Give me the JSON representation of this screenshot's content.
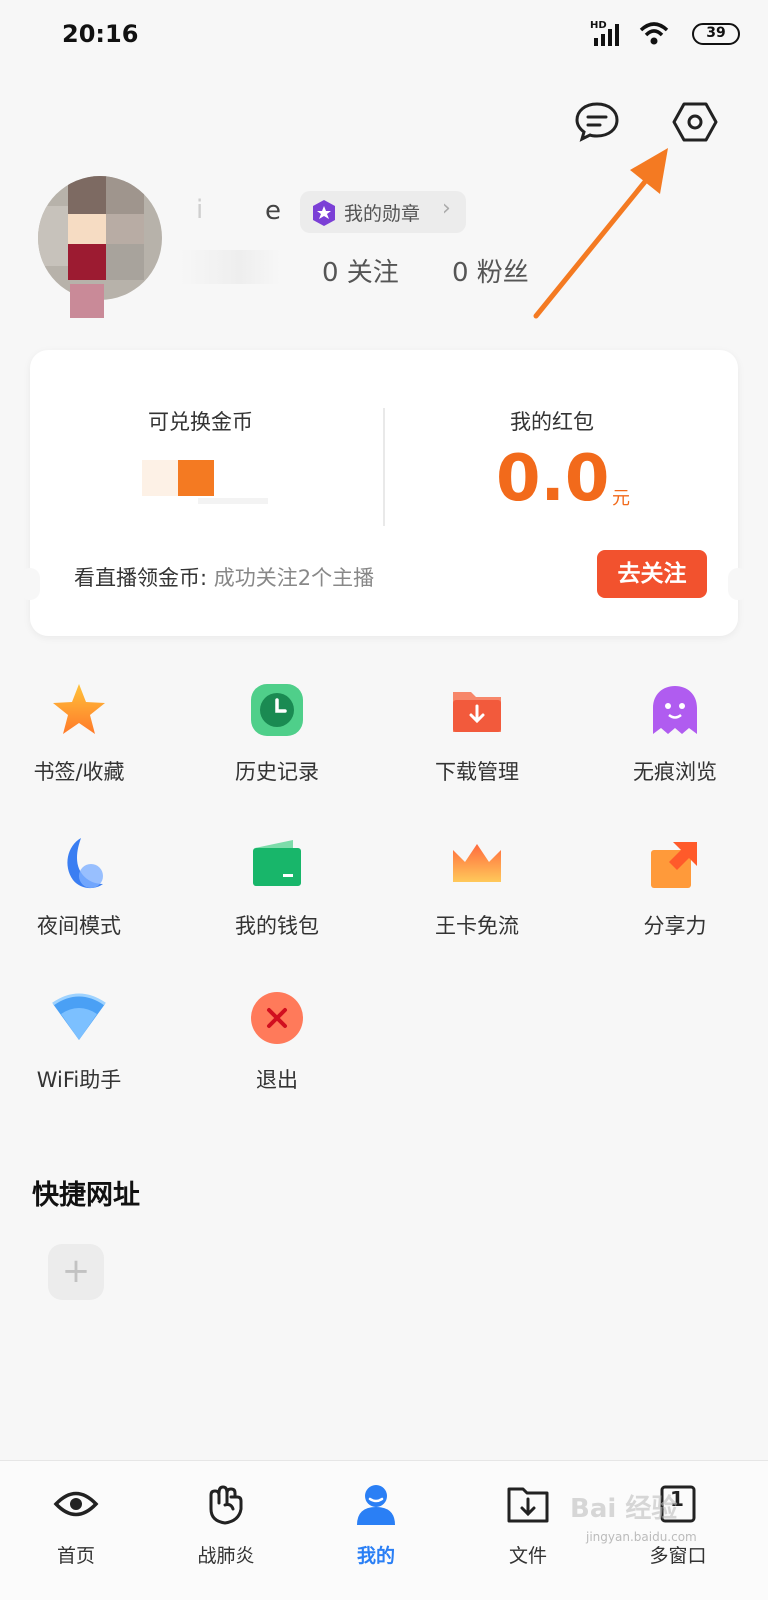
{
  "status_bar": {
    "time": "20:16",
    "network": "HD",
    "battery": "39"
  },
  "header": {
    "message_icon": "message-icon",
    "settings_icon": "settings-hexagon-icon"
  },
  "profile": {
    "username_visible": "e",
    "medal_label": "我的勋章",
    "following": "0 关注",
    "followers": "0 粉丝"
  },
  "wallet_card": {
    "coins_label": "可兑换金币",
    "redpacket_label": "我的红包",
    "redpacket_value": "0.0",
    "redpacket_unit": "元",
    "live_label": "看直播领金币:",
    "live_sub": "成功关注2个主播",
    "follow_button": "去关注"
  },
  "grid": [
    {
      "label": "书签/收藏",
      "icon": "star-icon"
    },
    {
      "label": "历史记录",
      "icon": "clock-icon"
    },
    {
      "label": "下载管理",
      "icon": "download-folder-icon"
    },
    {
      "label": "无痕浏览",
      "icon": "ghost-icon"
    },
    {
      "label": "夜间模式",
      "icon": "moon-icon"
    },
    {
      "label": "我的钱包",
      "icon": "wallet-icon"
    },
    {
      "label": "王卡免流",
      "icon": "crown-icon"
    },
    {
      "label": "分享力",
      "icon": "share-icon"
    },
    {
      "label": "WiFi助手",
      "icon": "wifi-icon"
    },
    {
      "label": "退出",
      "icon": "exit-icon"
    }
  ],
  "shortcuts": {
    "title": "快捷网址",
    "add_label": "+"
  },
  "bottom_nav": [
    {
      "label": "首页",
      "icon": "eye-icon",
      "active": false
    },
    {
      "label": "战肺炎",
      "icon": "fist-icon",
      "active": false
    },
    {
      "label": "我的",
      "icon": "person-icon",
      "active": true
    },
    {
      "label": "文件",
      "icon": "file-download-icon",
      "active": false
    },
    {
      "label": "多窗口",
      "icon": "window-count-icon",
      "active": false,
      "count": "1"
    }
  ],
  "watermark": {
    "text": "Bai 经验",
    "sub": "jingyan.baidu.com"
  },
  "colors": {
    "accent_orange": "#f26a1b",
    "active_blue": "#2a7ff5",
    "follow_red": "#f2522e",
    "arrow": "#f47a22"
  }
}
